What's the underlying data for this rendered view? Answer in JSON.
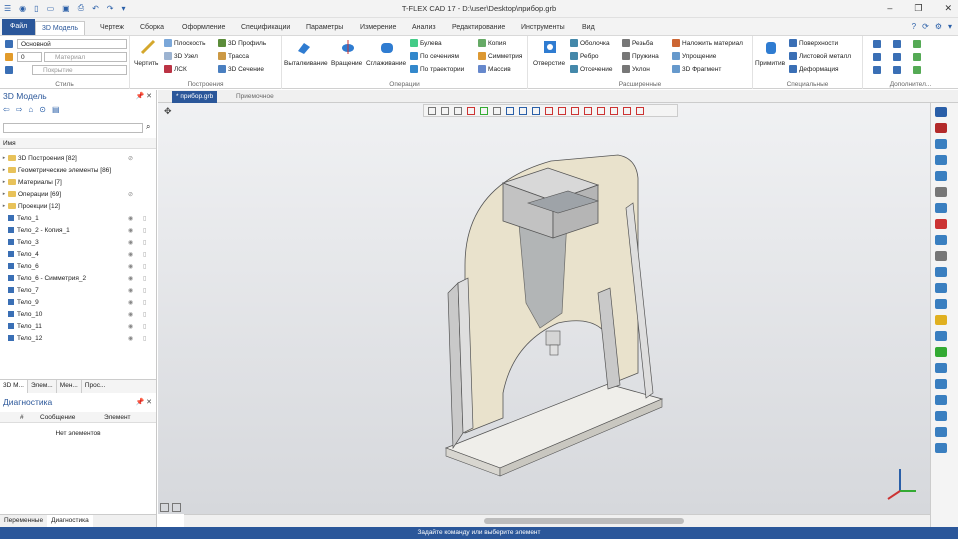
{
  "window": {
    "title": "T-FLEX CAD 17 - D:\\user\\Desktop\\прибор.grb"
  },
  "tabs": [
    "Файл",
    "3D Модель",
    "Чертеж",
    "Сборка",
    "Оформление",
    "Спецификации",
    "Параметры",
    "Измерение",
    "Анализ",
    "Редактирование",
    "Инструменты",
    "Вид"
  ],
  "ribbon": {
    "style": {
      "layer": "Основной",
      "num": "0",
      "material": "Материал",
      "cover": "Покрытие",
      "label": "Стиль"
    },
    "build": {
      "sketch": "Чертить",
      "plane": "Плоскость",
      "node": "3D Узел",
      "lsk": "ЛСК",
      "profile": "3D Профиль",
      "path": "Трасса",
      "section": "3D Сечение",
      "label": "Построения"
    },
    "ops": {
      "extrude": "Выталкивание",
      "revolve": "Вращение",
      "smooth": "Сглаживание",
      "bool": "Булева",
      "bysection": "По сечениям",
      "bytraj": "По траектории",
      "copy": "Копия",
      "sym": "Симметрия",
      "array": "Массив",
      "label": "Операции"
    },
    "ext": {
      "hole": "Отверстие",
      "shell": "Оболочка",
      "rib": "Ребро",
      "cut": "Отсечение",
      "thread": "Резьба",
      "spring": "Пружина",
      "slope": "Уклон",
      "applymat": "Наложить материал",
      "simplify": "Упрощение",
      "frag": "3D Фрагмент",
      "label": "Расширенные"
    },
    "special": {
      "prim": "Примитив",
      "surf": "Поверхности",
      "sheet": "Листовой металл",
      "deform": "Деформация",
      "label": "Специальные"
    },
    "extra": {
      "label": "Дополнител..."
    }
  },
  "leftpanel": {
    "title": "3D Модель",
    "col_name": "Имя",
    "tree": [
      {
        "label": "3D Построения [82]",
        "kind": "folder"
      },
      {
        "label": "Геометрические элементы [86]",
        "kind": "folder"
      },
      {
        "label": "Материалы [7]",
        "kind": "folder"
      },
      {
        "label": "Операции [69]",
        "kind": "folder"
      },
      {
        "label": "Проекции [12]",
        "kind": "folder"
      },
      {
        "label": "Тело_1",
        "kind": "body"
      },
      {
        "label": "Тело_2 - Копия_1",
        "kind": "body"
      },
      {
        "label": "Тело_3",
        "kind": "body"
      },
      {
        "label": "Тело_4",
        "kind": "body"
      },
      {
        "label": "Тело_6",
        "kind": "body"
      },
      {
        "label": "Тело_6 - Симметрия_2",
        "kind": "body"
      },
      {
        "label": "Тело_7",
        "kind": "body"
      },
      {
        "label": "Тело_9",
        "kind": "body"
      },
      {
        "label": "Тело_10",
        "kind": "body"
      },
      {
        "label": "Тело_11",
        "kind": "body"
      },
      {
        "label": "Тело_12",
        "kind": "body"
      }
    ],
    "bottomtabs": [
      "3D М...",
      "Элем...",
      "Мен...",
      "Прос..."
    ],
    "diag_title": "Диагностика",
    "diag_cols": [
      "#",
      "Сообщение",
      "Элемент"
    ],
    "diag_empty": "Нет элементов",
    "footertabs": [
      "Переменные",
      "Диагностика"
    ]
  },
  "doctabs": [
    "* прибор.grb",
    "Приемочное"
  ],
  "status": "Задайте команду или выберите элемент"
}
